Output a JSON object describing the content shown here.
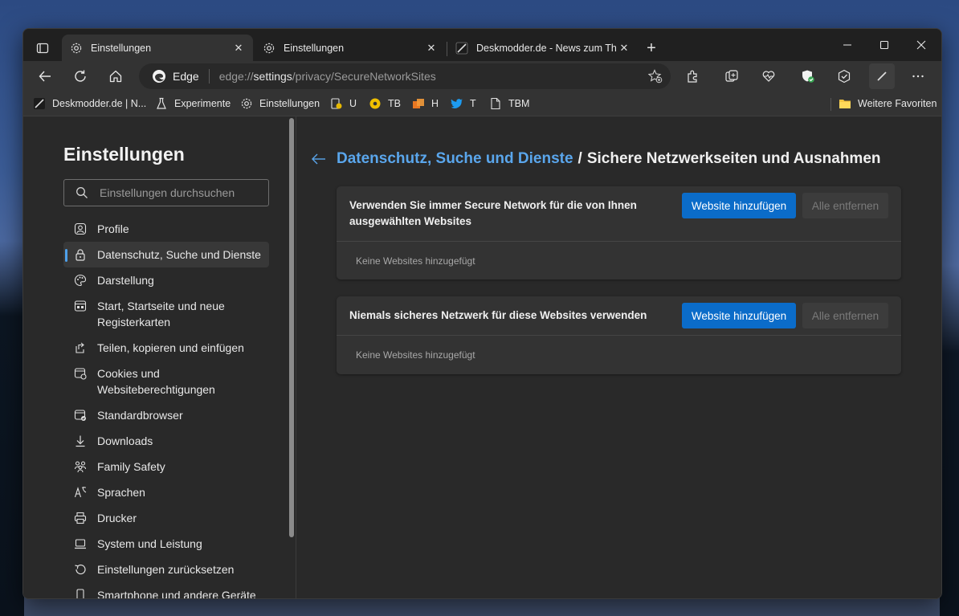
{
  "colors": {
    "accent": "#0b6cc9",
    "link": "#5aa6ec",
    "background": "#292929",
    "card": "#333333"
  },
  "tabs": [
    {
      "label": "Einstellungen",
      "icon": "gear-icon",
      "active": true
    },
    {
      "label": "Einstellungen",
      "icon": "gear-icon",
      "active": false
    },
    {
      "label": "Deskmodder.de - News zum The",
      "icon": "deskmodder-icon",
      "active": false
    }
  ],
  "address": {
    "site_label": "Edge",
    "url_prefix": "edge://",
    "url_bold": "settings",
    "url_rest": "/privacy/SecureNetworkSites"
  },
  "favorites": [
    {
      "label": "Deskmodder.de | N...",
      "icon": "deskmodder-icon"
    },
    {
      "label": "Experimente",
      "icon": "flask-icon"
    },
    {
      "label": "Einstellungen",
      "icon": "gear-icon"
    },
    {
      "label": "U",
      "icon": "bookmark-u-icon"
    },
    {
      "label": "TB",
      "icon": "bookmark-tb-icon"
    },
    {
      "label": "H",
      "icon": "bookmark-h-icon"
    },
    {
      "label": "T",
      "icon": "twitter-icon"
    },
    {
      "label": "TBM",
      "icon": "page-icon"
    }
  ],
  "favorites_more": "Weitere Favoriten",
  "sidebar": {
    "title": "Einstellungen",
    "search_placeholder": "Einstellungen durchsuchen",
    "items": [
      {
        "label": "Profile",
        "icon": "profile-icon"
      },
      {
        "label": "Datenschutz, Suche und Dienste",
        "icon": "lock-icon",
        "active": true
      },
      {
        "label": "Darstellung",
        "icon": "palette-icon"
      },
      {
        "label": "Start, Startseite und neue Registerkarten",
        "icon": "start-icon"
      },
      {
        "label": "Teilen, kopieren und einfügen",
        "icon": "share-icon"
      },
      {
        "label": "Cookies und Websiteberechtigungen",
        "icon": "cookies-icon"
      },
      {
        "label": "Standardbrowser",
        "icon": "browser-icon"
      },
      {
        "label": "Downloads",
        "icon": "download-icon"
      },
      {
        "label": "Family Safety",
        "icon": "family-icon"
      },
      {
        "label": "Sprachen",
        "icon": "language-icon"
      },
      {
        "label": "Drucker",
        "icon": "printer-icon"
      },
      {
        "label": "System und Leistung",
        "icon": "laptop-icon"
      },
      {
        "label": "Einstellungen zurücksetzen",
        "icon": "reset-icon"
      },
      {
        "label": "Smartphone und andere Geräte",
        "icon": "phone-icon"
      }
    ]
  },
  "main": {
    "breadcrumb_link": "Datenschutz, Suche und Dienste",
    "breadcrumb_sep": "/",
    "breadcrumb_current": "Sichere Netzwerkseiten und Ausnahmen",
    "cards": [
      {
        "title": "Verwenden Sie immer Secure Network für die von Ihnen ausgewählten Websites",
        "add_label": "Website hinzufügen",
        "remove_label": "Alle entfernen",
        "empty_text": "Keine Websites hinzugefügt"
      },
      {
        "title": "Niemals sicheres Netzwerk für diese Websites verwenden",
        "add_label": "Website hinzufügen",
        "remove_label": "Alle entfernen",
        "empty_text": "Keine Websites hinzugefügt"
      }
    ]
  }
}
